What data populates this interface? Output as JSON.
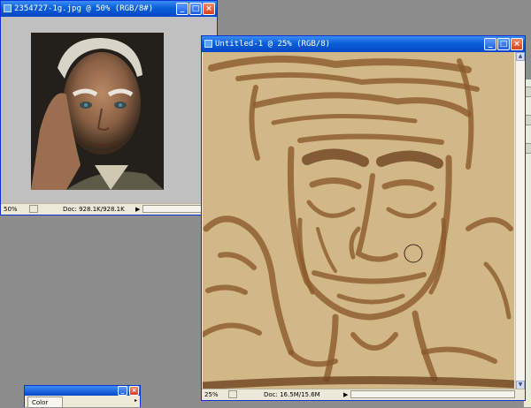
{
  "photo_window": {
    "title": "2354727-1g.jpg @ 50% (RGB/8#)",
    "zoom": "50%",
    "doc_info": "Doc: 928.1K/928.1K"
  },
  "canvas_window": {
    "title": "Untitled-1 @ 25% (RGB/8)",
    "zoom": "25%",
    "doc_info": "Doc: 16.5M/15.6M"
  },
  "color_panel": {
    "tab_label": "Color"
  },
  "window_buttons": {
    "minimize": "_",
    "maximize": "□",
    "close": "×"
  },
  "colors": {
    "canvas_bg": "#d2b787",
    "stroke": "#8c5a2c",
    "stroke_dark": "#6e4420",
    "workspace": "#8d8d8d"
  }
}
